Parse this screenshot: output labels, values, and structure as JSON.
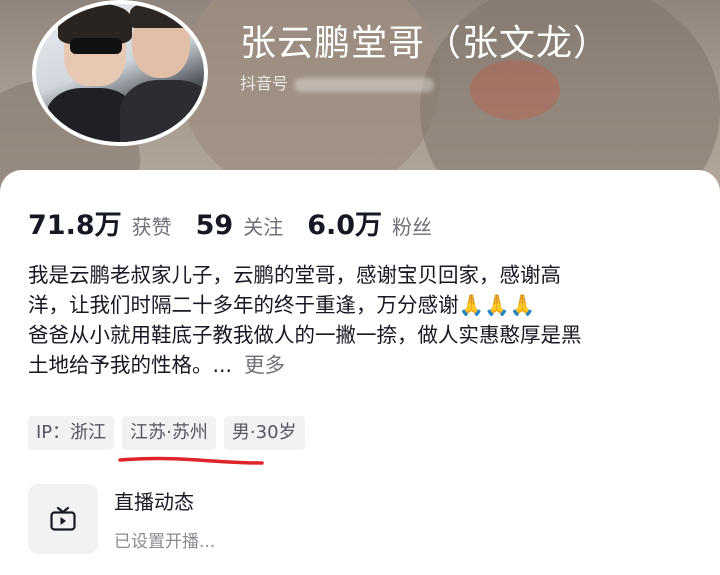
{
  "profile": {
    "nickname": "张云鹏堂哥（张文龙）",
    "douyin_id_label": "抖音号"
  },
  "stats": [
    {
      "value": "71.8万",
      "label": "获赞"
    },
    {
      "value": "59",
      "label": "关注"
    },
    {
      "value": "6.0万",
      "label": "粉丝"
    }
  ],
  "bio": {
    "lines": [
      "我是云鹏老叔家儿子，云鹏的堂哥，感谢宝贝回家，感谢高",
      "洋，让我们时隔二十多年的终于重逢，万分感谢🙏🙏🙏",
      "爸爸从小就用鞋底子教我做人的一撇一捺，做人实惠憨厚是黑",
      "土地给予我的性格。..."
    ],
    "more_label": "更多"
  },
  "tags": {
    "ip": "IP：浙江",
    "location": "江苏·苏州",
    "gender_age": "男·30岁"
  },
  "live": {
    "title": "直播动态",
    "subtitle": "已设置开播..."
  },
  "colors": {
    "annotation_underline": "#e0242b",
    "tag_background": "#f2f2f4"
  }
}
